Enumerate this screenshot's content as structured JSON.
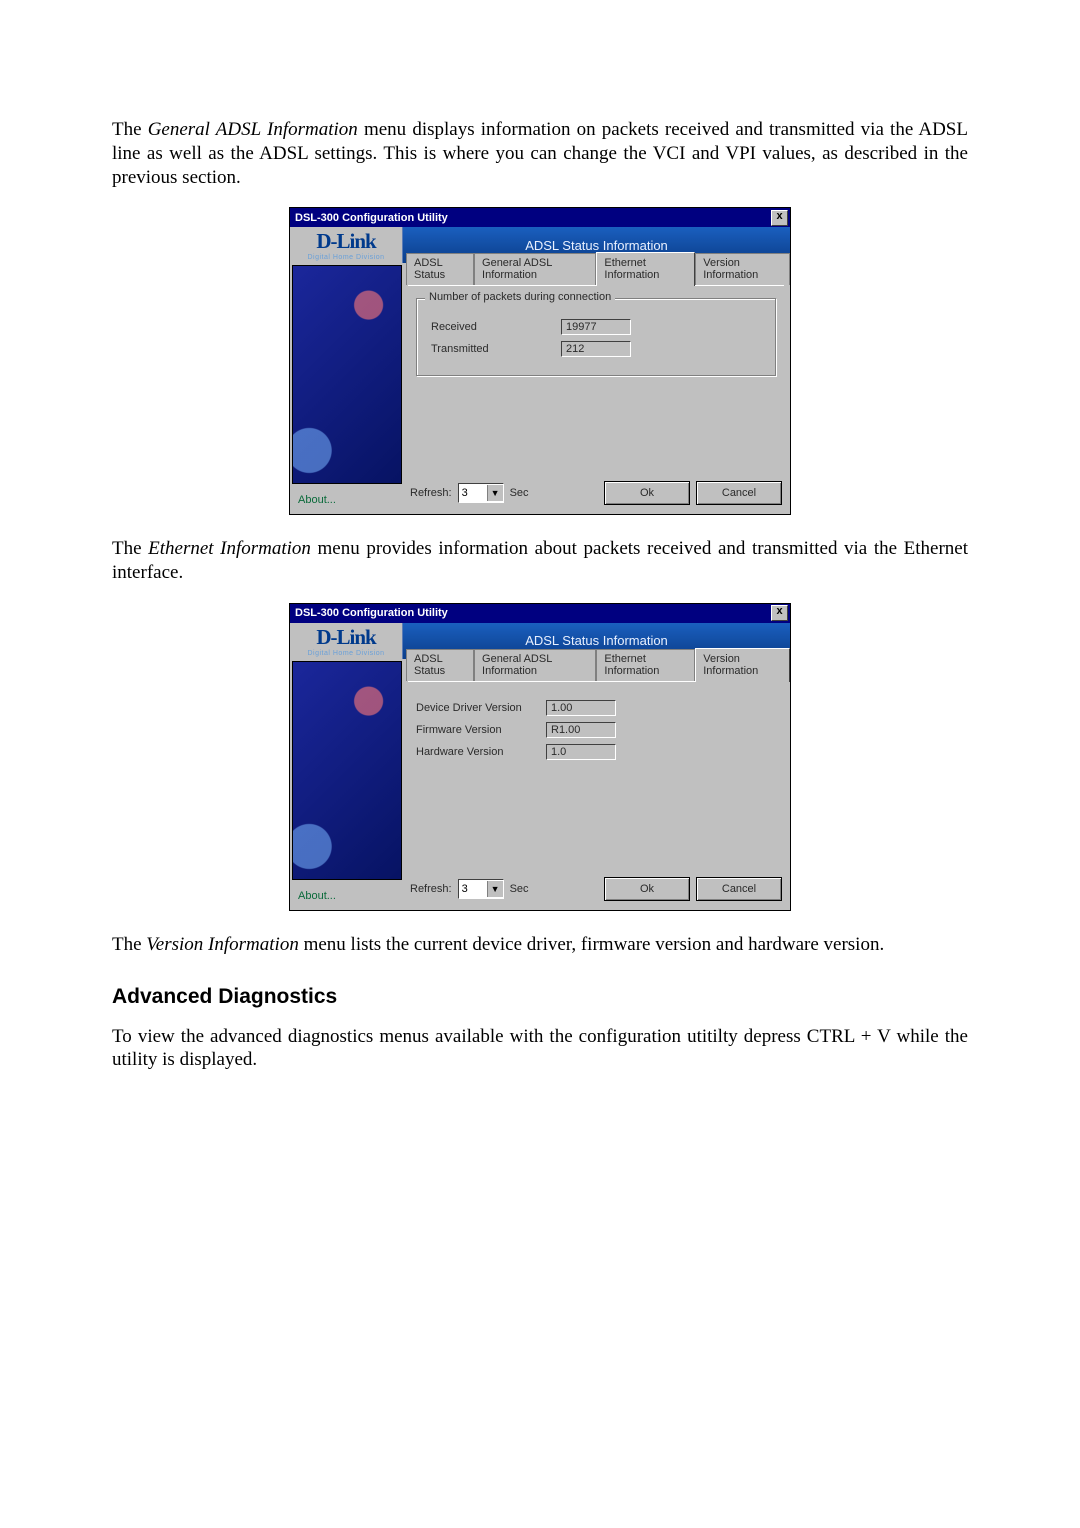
{
  "intro_para_1a": "The ",
  "intro_para_1b": "General ADSL Information",
  "intro_para_1c": " menu displays information on packets received and transmitted via the ADSL line as well as the ADSL settings. This is where you can change the VCI and VPI values, as described in the previous section.",
  "intro_para_2a": "The ",
  "intro_para_2b": "Ethernet Information",
  "intro_para_2c": " menu provides information about packets received and transmitted via the Ethernet interface.",
  "intro_para_3a": "The ",
  "intro_para_3b": "Version Information",
  "intro_para_3c": " menu lists the current device driver, firmware version and hardware version.",
  "heading_advdiag": "Advanced Diagnostics",
  "advdiag_para": "To view the advanced diagnostics menus available with the configuration utitilty depress CTRL + V while the utility is displayed.",
  "dialog_title": "DSL-300 Configuration Utility",
  "banner_text": "ADSL Status Information",
  "brand": "D-Link",
  "brand_sub": "Digital Home Division",
  "tabs": {
    "adsl_status": "ADSL Status",
    "general_adsl": "General ADSL Information",
    "ethernet": "Ethernet Information",
    "version": "Version Information"
  },
  "ethernet_panel": {
    "group_legend": "Number of packets during connection",
    "received_label": "Received",
    "received_value": "19977",
    "transmitted_label": "Transmitted",
    "transmitted_value": "212"
  },
  "version_panel": {
    "driver_label": "Device Driver Version",
    "driver_value": "1.00",
    "firmware_label": "Firmware Version",
    "firmware_value": "R1.00",
    "hardware_label": "Hardware Version",
    "hardware_value": "1.0"
  },
  "footer": {
    "about": "About...",
    "refresh_label": "Refresh:",
    "refresh_value": "3",
    "sec_label": "Sec",
    "ok": "Ok",
    "cancel": "Cancel"
  },
  "close_glyph": "x"
}
